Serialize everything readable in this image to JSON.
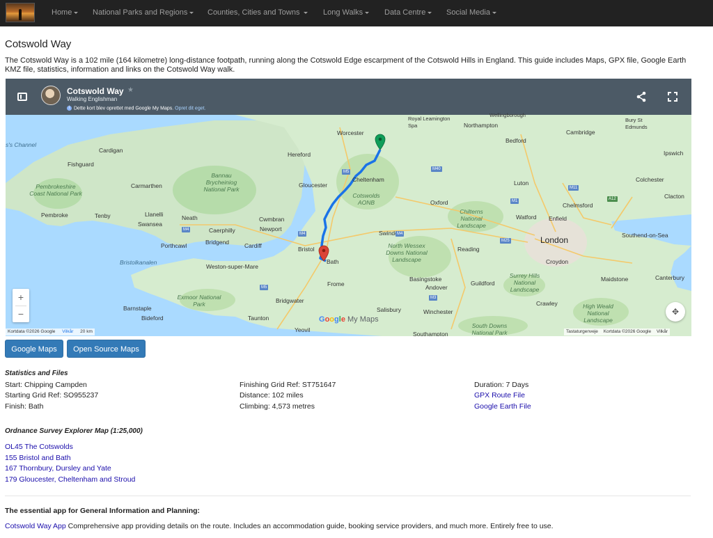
{
  "nav": {
    "items": [
      "Home",
      "National Parks and Regions",
      "Counties, Cities and Towns",
      "Long Walks",
      "Data Centre",
      "Social Media"
    ]
  },
  "page": {
    "title": "Cotswold Way",
    "intro": "The Cotswold Way is a 102 mile (164 kilometre) long-distance footpath, running along the Cotswold Edge escarpment of the Cotswold Hills in England. This guide includes Maps, GPX file, Google Earth KMZ file, statistics, information and links on the Cotswold Way walk."
  },
  "map": {
    "title": "Cotswold Way",
    "author": "Walking Englishman",
    "note": "Dette kort blev oprettet med Google My Maps.",
    "note_link": "Opret dit eget.",
    "logo": "Google My Maps",
    "attrib_left": "Kortdata ©2026 Google",
    "attrib_terms": "Vilkår",
    "attrib_scale": "20 km",
    "attrib_right_1": "Tastaturgenveje",
    "attrib_right_2": "Kortdata ©2026 Google",
    "attrib_right_3": "Vilkår",
    "labels": {
      "channel": "s's Channel",
      "cardigan": "Cardigan",
      "fishguard": "Fishguard",
      "pembrokeshire": "Pembrokeshire Coast National Park",
      "pembroke": "Pembroke",
      "tenby": "Tenby",
      "carmarthen": "Carmarthen",
      "bannau": "Bannau Brycheiniog National Park",
      "llanelli": "Llanelli",
      "neath": "Neath",
      "swansea": "Swansea",
      "caerphilly": "Caerphilly",
      "cwmbran": "Cwmbran",
      "newport": "Newport",
      "porthcawl": "Porthcawl",
      "bridgend": "Bridgend",
      "cardiff": "Cardiff",
      "bristolkanalen": "Bristolkanalen",
      "weston": "Weston-super-Mare",
      "exmoor": "Exmoor National Park",
      "barnstaple": "Barnstaple",
      "bideford": "Bideford",
      "taunton": "Taunton",
      "yeovil": "Yeovil",
      "bridgwater": "Bridgwater",
      "frome": "Frome",
      "bristol": "Bristol",
      "bath": "Bath",
      "hereford": "Hereford",
      "worcester": "Worcester",
      "gloucester": "Gloucester",
      "cheltenham": "Cheltenham",
      "cotswolds": "Cotswolds AONB",
      "swindon": "Swindon",
      "oxford": "Oxford",
      "northwessex": "North Wessex Downs National Landscape",
      "chilterns": "Chilterns National Landscape",
      "reading": "Reading",
      "basingstoke": "Basingstoke",
      "andover": "Andover",
      "salisbury": "Salisbury",
      "winchester": "Winchester",
      "southampton": "Southampton",
      "southdowns": "South Downs National Park",
      "guildford": "Guildford",
      "surreyhills": "Surrey Hills National Landscape",
      "crawley": "Crawley",
      "highweald": "High Weald National Landscape",
      "london": "London",
      "croydon": "Croydon",
      "watford": "Watford",
      "enfield": "Enfield",
      "luton": "Luton",
      "chelmsford": "Chelmsford",
      "southend": "Southend-on-Sea",
      "maidstone": "Maidstone",
      "canterbury": "Canterbury",
      "colchester": "Colchester",
      "clacton": "Clacton",
      "ipswich": "Ipswich",
      "cambridge": "Cambridge",
      "bedford": "Bedford",
      "northampton": "Northampton",
      "leamington": "Royal Leamington Spa",
      "bury": "Bury St Edmunds",
      "wellingborough": "Wellingborough"
    },
    "roads": [
      "M5",
      "M40",
      "M4",
      "M4",
      "M1",
      "M11",
      "M25",
      "M3",
      "M5",
      "A12",
      "M4"
    ]
  },
  "buttons": {
    "google": "Google Maps",
    "osm": "Open Source Maps"
  },
  "stats": {
    "heading": "Statistics and Files",
    "start": "Start: Chipping Campden",
    "start_grid": "Starting Grid Ref: SO955237",
    "finish": "Finish: Bath",
    "finish_grid": "Finishing Grid Ref: ST751647",
    "distance": "Distance: 102 miles",
    "climbing": "Climbing: 4,573 metres",
    "duration": "Duration: 7 Days",
    "gpx": "GPX Route File",
    "kmz": "Google Earth File"
  },
  "os": {
    "heading": "Ordnance Survey Explorer Map (1:25,000)",
    "maps": [
      "OL45 The Cotswolds",
      "155 Bristol and Bath",
      "167 Thornbury, Dursley and Yate",
      "179 Gloucester, Cheltenham and Stroud"
    ]
  },
  "app": {
    "heading": "The essential app for General Information and Planning:",
    "link": "Cotswold Way App",
    "desc": "Comprehensive app providing details on the route. Includes an accommodation guide, booking service providers, and much more. Entirely free to use."
  },
  "colors": {
    "route": "#1a73e8",
    "start_pin": "#0f9d58",
    "end_pin": "#db4437",
    "button": "#337ab7"
  }
}
